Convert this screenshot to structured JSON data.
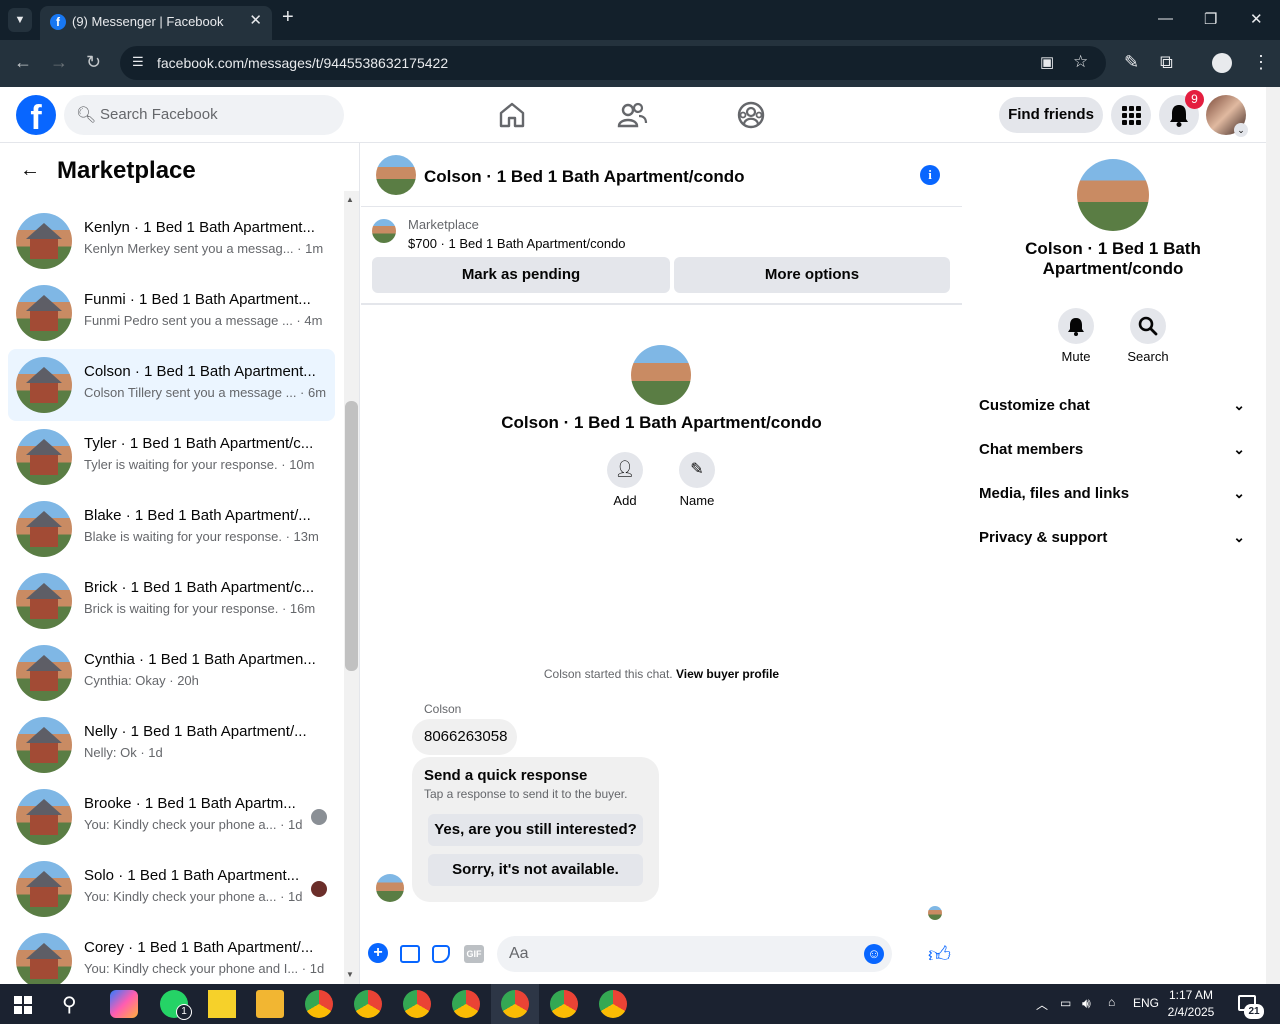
{
  "browser": {
    "tab_title": "(9) Messenger | Facebook",
    "url": "facebook.com/messages/t/9445538632175422"
  },
  "fb": {
    "search_placeholder": "Search Facebook",
    "find_friends": "Find friends",
    "notif_count": "9"
  },
  "left": {
    "title": "Marketplace",
    "conversations": [
      {
        "name": "Kenlyn · 1 Bed 1 Bath Apartment...",
        "snippet": "Kenlyn Merkey sent you a messag... · 1m"
      },
      {
        "name": "Funmi · 1 Bed 1 Bath Apartment...",
        "snippet": "Funmi Pedro sent you a message ... · 4m"
      },
      {
        "name": "Colson · 1 Bed 1 Bath Apartment...",
        "snippet": "Colson Tillery sent you a message ... · 6m"
      },
      {
        "name": "Tyler · 1 Bed 1 Bath Apartment/c...",
        "snippet": "Tyler is waiting for your response. · 10m"
      },
      {
        "name": "Blake · 1 Bed 1 Bath Apartment/...",
        "snippet": "Blake is waiting for your response. · 13m"
      },
      {
        "name": "Brick · 1 Bed 1 Bath Apartment/c...",
        "snippet": "Brick is waiting for your response. · 16m"
      },
      {
        "name": "Cynthia · 1 Bed 1 Bath Apartmen...",
        "snippet": "Cynthia: Okay · 20h"
      },
      {
        "name": "Nelly · 1 Bed 1 Bath Apartment/...",
        "snippet": "Nelly: Ok · 1d"
      },
      {
        "name": "Brooke · 1 Bed 1 Bath Apartm...",
        "snippet": "You: Kindly check your phone a... · 1d"
      },
      {
        "name": "Solo · 1 Bed 1 Bath Apartment...",
        "snippet": "You: Kindly check your phone a... · 1d"
      },
      {
        "name": "Corey · 1 Bed 1 Bath Apartment/...",
        "snippet": "You: Kindly check your phone and I... · 1d"
      }
    ]
  },
  "chat": {
    "header_title": "Colson · 1 Bed 1 Bath Apartment/condo",
    "marketplace_label": "Marketplace",
    "listing": "$700 · 1 Bed 1 Bath Apartment/condo",
    "mark_pending": "Mark as pending",
    "more_options": "More options",
    "center_title": "Colson · 1 Bed 1 Bath Apartment/condo",
    "add_label": "Add",
    "name_label": "Name",
    "started_text": "Colson started this chat.",
    "view_profile": "View buyer profile",
    "sender": "Colson",
    "message": "8066263058",
    "quick_title": "Send a quick response",
    "quick_sub": "Tap a response to send it to the buyer.",
    "quick_1": "Yes, are you still interested?",
    "quick_2": "Sorry, it's not available.",
    "compose_placeholder": "Aa"
  },
  "right": {
    "title": "Colson · 1 Bed 1 Bath Apartment/condo",
    "mute": "Mute",
    "search": "Search",
    "sections": [
      "Customize chat",
      "Chat members",
      "Media, files and links",
      "Privacy & support"
    ]
  },
  "taskbar": {
    "whatsapp_badge": "1",
    "lang": "ENG",
    "time": "1:17 AM",
    "date": "2/4/2025",
    "notif": "21"
  }
}
